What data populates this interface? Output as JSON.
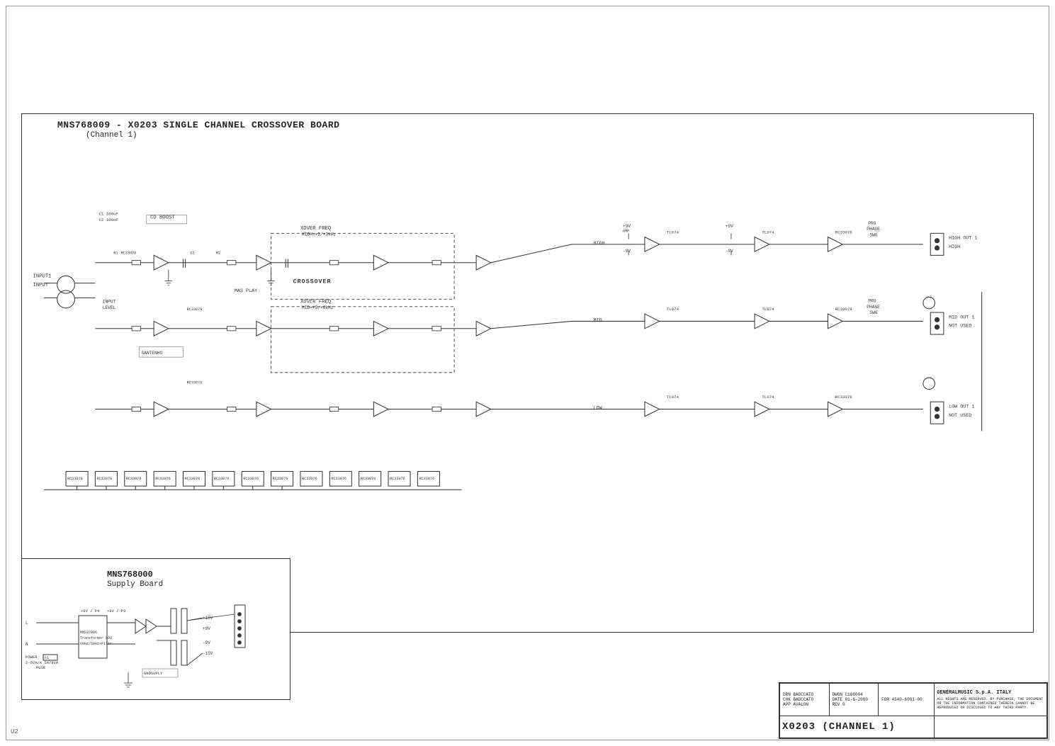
{
  "page": {
    "background": "#ffffff",
    "border_color": "#999999"
  },
  "board": {
    "main_title": "MNS768009 - X0203 SINGLE CHANNEL CROSSOVER BOARD",
    "main_subtitle": "(Channel 1)",
    "crossover_label": "CROSSOVER",
    "supply_title": "MNS768000",
    "supply_subtitle": "Supply Board"
  },
  "right_labels": {
    "high_out_1": "HIGH OUT 1",
    "high": "HIGH",
    "mid_out_1": "MID OUT 1",
    "not_used_1": "NOT USED",
    "low_out_1": "LOW OUT 1",
    "not_used_2": "NOT USED"
  },
  "title_block": {
    "drn_label": "DRN",
    "drn_value": "BADCCATO",
    "chk_label": "CHK",
    "chk_value": "BADCCATO",
    "app_label": "APP",
    "app_value": "AVALON",
    "dwgn_label": "DWGN",
    "dwgn_value": "C168004",
    "date_label": "DATE",
    "date_value": "01-6-2000",
    "rev_label": "REV",
    "rev_value": "0",
    "fon_label": "FOR",
    "fon_value": "4540-6001-00",
    "company": "GENERALMUSIC S.p.A. ITALY",
    "description": "ALL RIGHTS ARE RESERVED. BY PURCHASE, THE DOCUMENT OR THE INFORMATION CONTAINED THEREIN CANNOT BE REPRODUCED OR DISCLOSED TO ANY THIRD PARTY.",
    "doc_number": "X0203 (CHANNEL 1)"
  },
  "corner_markers": {
    "bottom_left": "U2"
  },
  "input_labels": {
    "input1": "INPUT1",
    "input": "INPUT"
  }
}
